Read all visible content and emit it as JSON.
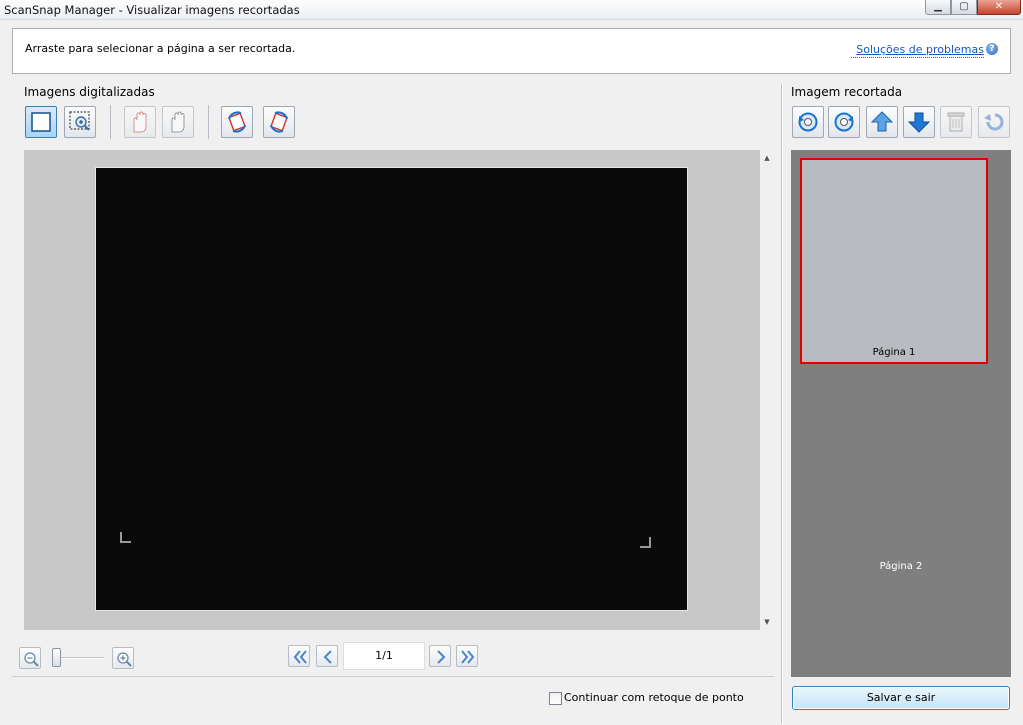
{
  "window": {
    "title": "ScanSnap Manager - Visualizar imagens recortadas",
    "min_glyph": "▁",
    "max_glyph": "▢",
    "close_glyph": "✕"
  },
  "instructions": {
    "text": "Arraste para selecionar a página a ser recortada.",
    "help_link": "Soluções de problemas",
    "help_glyph": "?"
  },
  "left_panel": {
    "label": "Imagens digitalizadas",
    "toolbar": [
      {
        "icon": "select-area-icon",
        "state": "selected"
      },
      {
        "icon": "select-zoom-icon",
        "state": "normal"
      },
      {
        "icon": "hand-red-icon",
        "state": "disabled"
      },
      {
        "icon": "hand-icon",
        "state": "disabled"
      },
      {
        "icon": "rotate-left-icon",
        "state": "normal"
      },
      {
        "icon": "rotate-right-icon",
        "state": "normal"
      }
    ],
    "scroll_up_glyph": "▲",
    "scroll_down_glyph": "▼"
  },
  "navigation": {
    "page_indicator": "1/1",
    "icons": [
      "zoom-out-icon",
      "zoom-in-icon",
      "first-page-icon",
      "previous-page-icon",
      "next-page-icon",
      "last-page-icon"
    ],
    "zoom_level": 0
  },
  "options": {
    "checkbox_label": "Continuar com retoque de ponto",
    "checked": false
  },
  "right_panel": {
    "label": "Imagem recortada",
    "toolbar": [
      "rotate-page-left-icon",
      "rotate-page-right-icon",
      "move-up-icon",
      "move-down-icon",
      "delete-icon",
      "undo-icon"
    ],
    "pages": [
      {
        "label": "Página 1",
        "selected": true
      },
      {
        "label": "Página 2",
        "selected": false
      }
    ],
    "save_button": "Salvar e sair"
  },
  "colors": {
    "selection_border": "#e00000",
    "accent_blue": "#1a73d0",
    "link": "#1a55c4",
    "rotate_red": "#d0302a"
  }
}
